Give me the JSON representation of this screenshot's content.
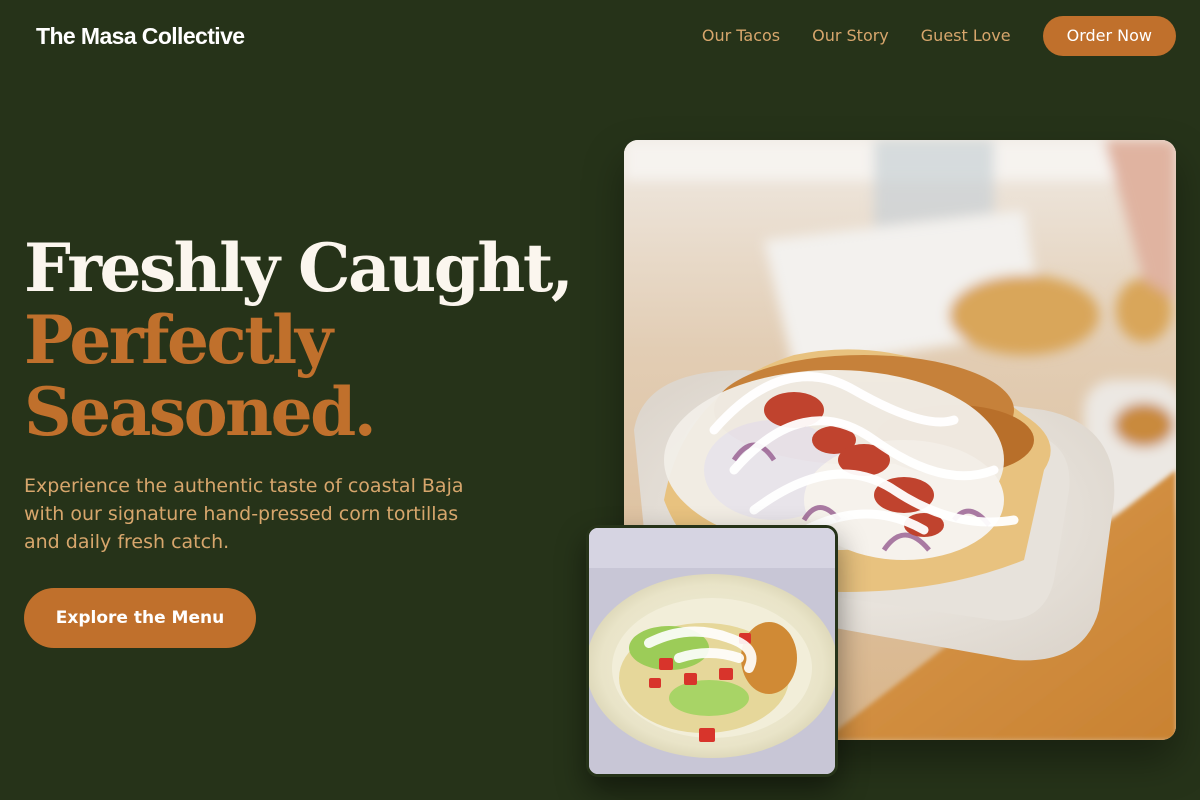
{
  "brand": "The Masa Collective",
  "nav": {
    "links": [
      "Our Tacos",
      "Our Story",
      "Guest Love"
    ],
    "cta": "Order Now"
  },
  "hero": {
    "title_line1": "Freshly Caught,",
    "title_accent_line1": "Perfectly",
    "title_accent_line2": "Seasoned.",
    "subtitle": "Experience the authentic taste of coastal Baja with our signature hand-pressed corn tortillas and daily fresh catch.",
    "cta": "Explore the Menu"
  },
  "colors": {
    "background": "#263319",
    "accent": "#c0702c",
    "muted_text": "#d7a66c",
    "heading": "#ffffff"
  },
  "images": {
    "main": "fish-taco-in-tray-photo",
    "secondary": "fish-taco-on-plate-photo"
  }
}
